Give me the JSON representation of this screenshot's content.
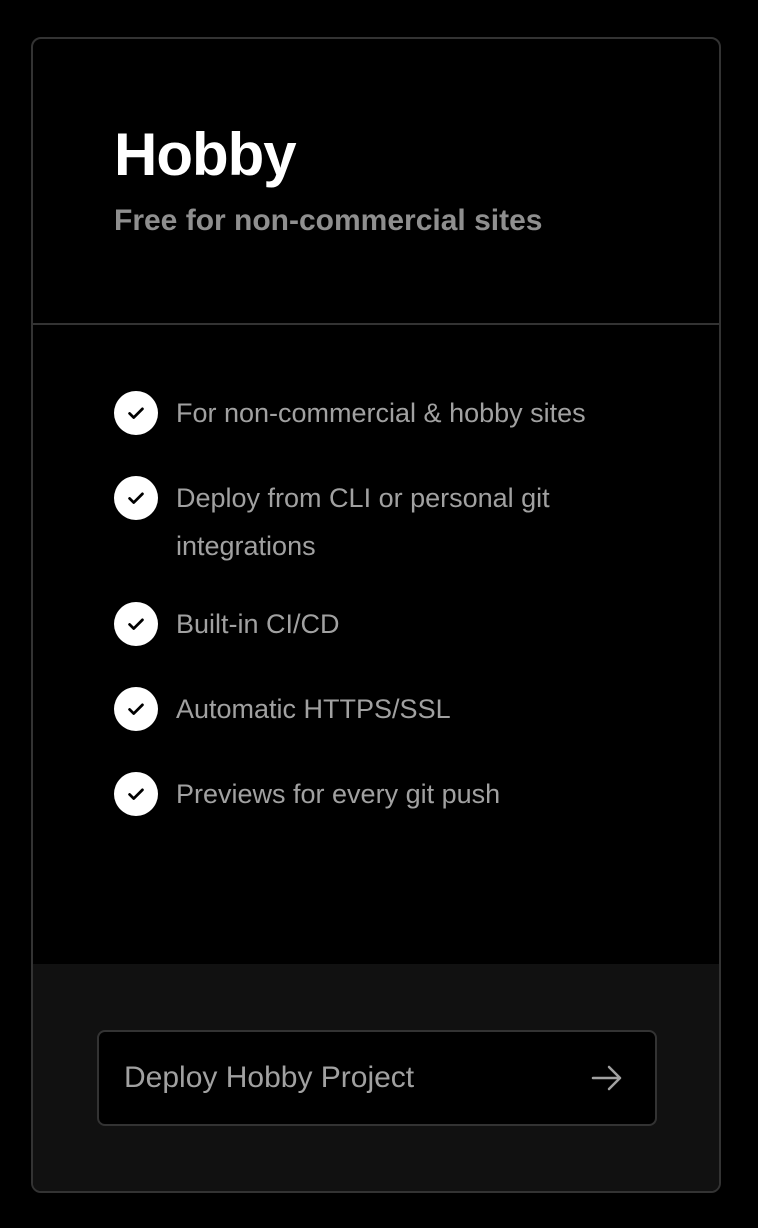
{
  "plan": {
    "title": "Hobby",
    "subtitle": "Free for non-commercial sites"
  },
  "features": [
    {
      "label": "For non-commercial & hobby sites",
      "icon": "check-circle-icon"
    },
    {
      "label": "Deploy from CLI or personal git integrations",
      "icon": "check-circle-icon"
    },
    {
      "label": "Built-in CI/CD",
      "icon": "check-circle-icon"
    },
    {
      "label": "Automatic HTTPS/SSL",
      "icon": "check-circle-icon"
    },
    {
      "label": "Previews for every git push",
      "icon": "check-circle-icon"
    }
  ],
  "cta": {
    "label": "Deploy Hobby Project",
    "icon": "arrow-right-icon"
  },
  "colors": {
    "background": "#000000",
    "border": "#333333",
    "title": "#ffffff",
    "muted_text": "#a1a1a1",
    "footer_background": "#111111"
  }
}
